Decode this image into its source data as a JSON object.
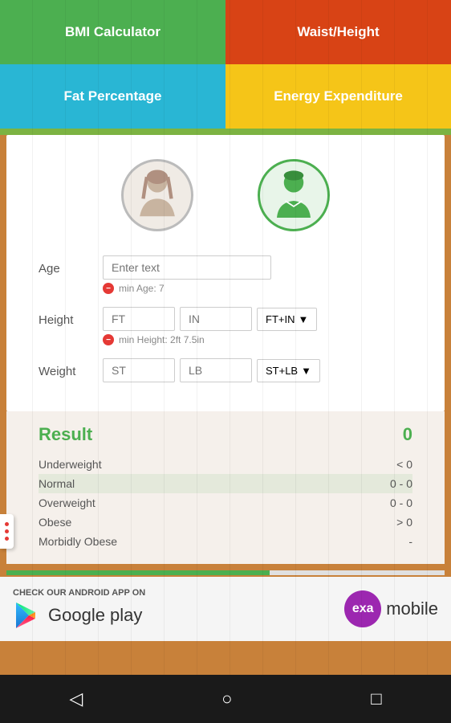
{
  "nav": {
    "bmi_label": "BMI Calculator",
    "waist_label": "Waist/Height",
    "fat_label": "Fat Percentage",
    "energy_label": "Energy Expenditure"
  },
  "form": {
    "age_label": "Age",
    "age_placeholder": "Enter text",
    "age_error": "min Age: 7",
    "height_label": "Height",
    "height_ft_placeholder": "FT",
    "height_in_placeholder": "IN",
    "height_unit": "FT+IN",
    "height_error": "min Height: 2ft 7.5in",
    "weight_label": "Weight",
    "weight_st_placeholder": "ST",
    "weight_lb_placeholder": "LB",
    "weight_unit": "ST+LB"
  },
  "result": {
    "title": "Result",
    "value": "0",
    "rows": [
      {
        "label": "Underweight",
        "range": "< 0"
      },
      {
        "label": "Normal",
        "range": "0 - 0"
      },
      {
        "label": "Overweight",
        "range": "0 - 0"
      },
      {
        "label": "Obese",
        "range": "> 0"
      },
      {
        "label": "Morbidly Obese",
        "range": "-"
      }
    ]
  },
  "ad": {
    "title": "CHECK OUR ANDROID APP ON",
    "google_play": "Google play",
    "exa_text": "exa",
    "mobile_text": "mobile"
  },
  "bottom_nav": {
    "back": "◁",
    "home": "○",
    "square": "□"
  },
  "colors": {
    "bmi_green": "#4caf50",
    "waist_orange": "#d84315",
    "fat_blue": "#29b6d4",
    "energy_yellow": "#f5c518",
    "result_green": "#4caf50"
  }
}
